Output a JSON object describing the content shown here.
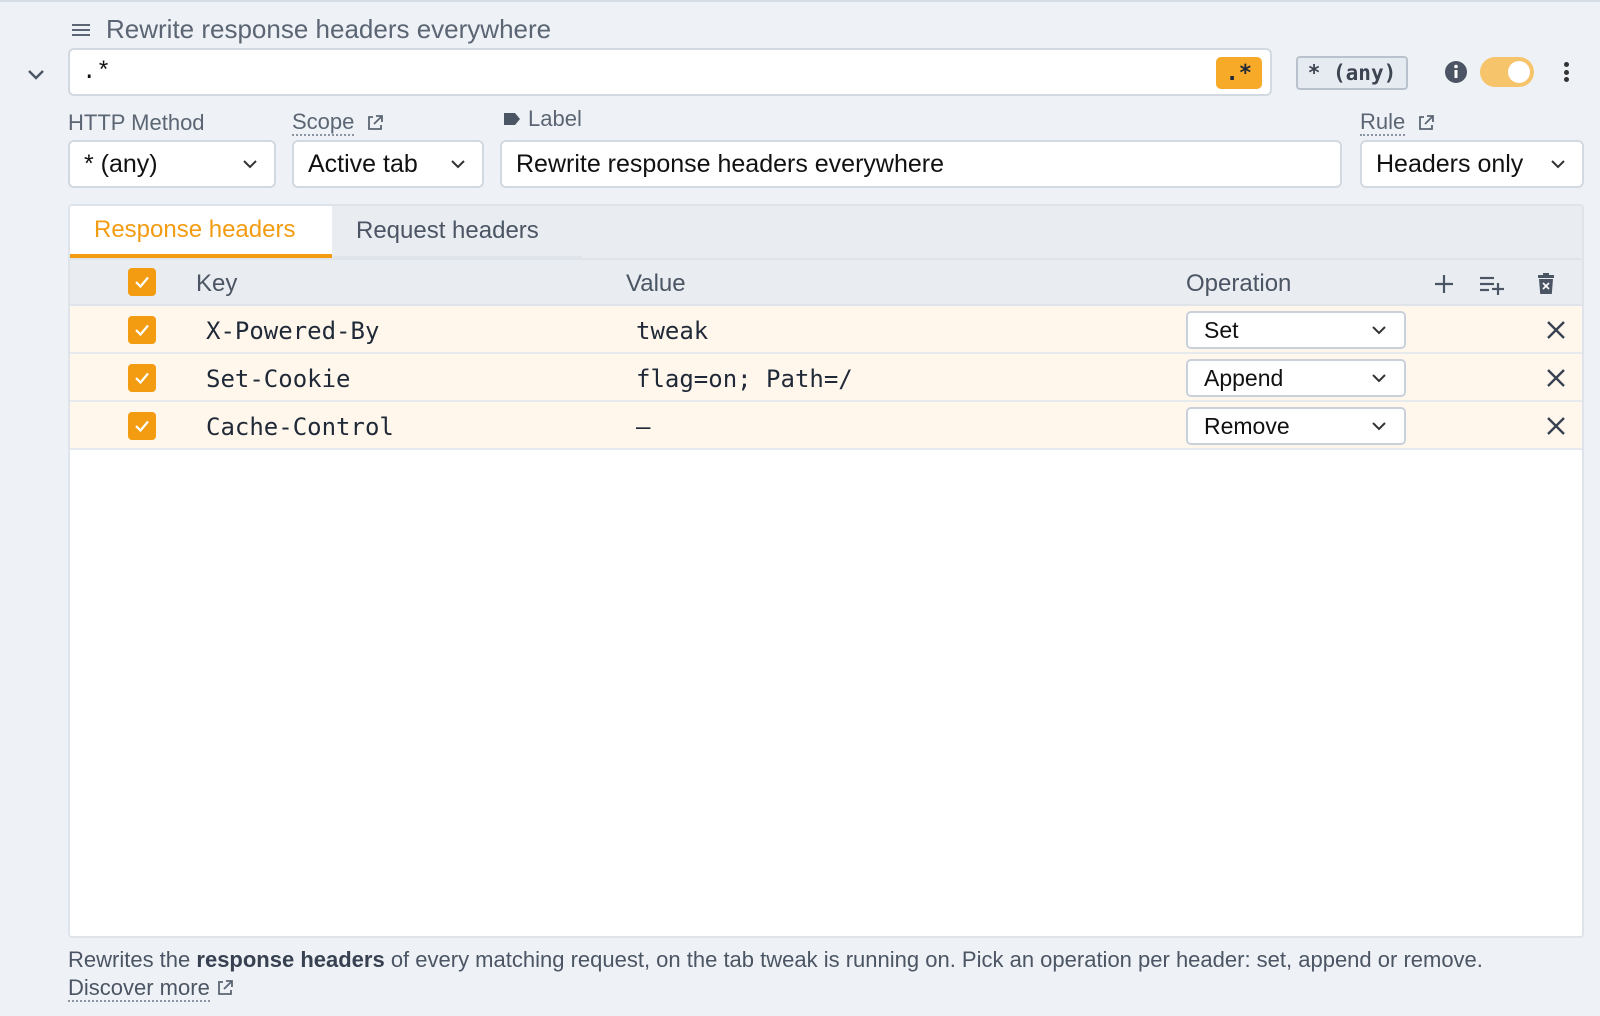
{
  "rule": {
    "title": "Rewrite response headers everywhere",
    "url_pattern": ".*",
    "regex_badge": ".*",
    "method_chip": "* (any)"
  },
  "fields": {
    "http_method_label": "HTTP Method",
    "http_method_value": "* (any)",
    "scope_label": "Scope",
    "scope_value": "Active tab",
    "label_label": "Label",
    "label_value": "Rewrite response headers everywhere",
    "rule_label": "Rule",
    "rule_value": "Headers only"
  },
  "tabs": [
    {
      "label": "Response headers",
      "active": true
    },
    {
      "label": "Request headers",
      "active": false
    }
  ],
  "table": {
    "columns": {
      "key": "Key",
      "value": "Value",
      "operation": "Operation"
    },
    "rows": [
      {
        "key": "X-Powered-By",
        "value": "tweak",
        "operation": "Set",
        "checked": true
      },
      {
        "key": "Set-Cookie",
        "value": "flag=on; Path=/",
        "operation": "Append",
        "checked": true
      },
      {
        "key": "Cache-Control",
        "value": "—",
        "operation": "Remove",
        "checked": true
      }
    ]
  },
  "footer": {
    "text_1": "Rewrites the ",
    "bold": "response headers",
    "text_2": " of every matching request, on the tab tweak is running on. Pick an operation per header: set, append or remove. ",
    "link": "Discover more"
  },
  "colors": {
    "accent": "#f39c12",
    "toggle": "#f6c56b",
    "row_highlight": "#fff7ec"
  }
}
